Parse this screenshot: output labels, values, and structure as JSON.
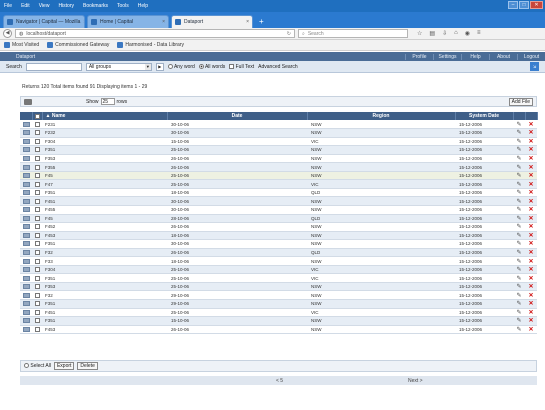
{
  "browser": {
    "menu": [
      "File",
      "Edit",
      "View",
      "History",
      "Bookmarks",
      "Tools",
      "Help"
    ],
    "tabs": [
      {
        "label": "Navigator | Capital — Mozilla",
        "active": false
      },
      {
        "label": "Home | Capital",
        "active": false
      },
      {
        "label": "Dataport",
        "active": true
      }
    ],
    "url": "localhost/dataport",
    "search_placeholder": "Search",
    "bookmarks": [
      "Most Visited",
      "Commissioned Gateway",
      "Harmonised - Data Library"
    ]
  },
  "app": {
    "title": "Dataport",
    "nav": [
      "Profile",
      "Settings",
      "Help",
      "About",
      "Logout"
    ],
    "search": {
      "label": "Search",
      "field_select": "All groups",
      "go_label": "Go",
      "radio_any": "Any word",
      "radio_all": "All words",
      "fulltext": "Full Text",
      "advanced": "Advanced Search"
    },
    "results_text": "Returns 120 Total items found 91 Displaying items 1 - 29",
    "toolbar": {
      "show_label": "Show",
      "page_size": "25",
      "show_suffix": "rows",
      "add_label": "Add File"
    },
    "columns": {
      "name": "Name",
      "date": "Date",
      "region": "Region",
      "system_date": "System Date"
    },
    "rows": [
      {
        "name": "F231",
        "date": "30-10-06",
        "region": "NSW",
        "sys": "15-12-2006"
      },
      {
        "name": "F232",
        "date": "30-10-06",
        "region": "NSW",
        "sys": "15-12-2006"
      },
      {
        "name": "F304",
        "date": "15-10-06",
        "region": "VIC",
        "sys": "15-12-2006"
      },
      {
        "name": "F351",
        "date": "25-10-06",
        "region": "NSW",
        "sys": "15-12-2006"
      },
      {
        "name": "F353",
        "date": "26-10-06",
        "region": "NSW",
        "sys": "15-12-2006"
      },
      {
        "name": "F355",
        "date": "26-10-06",
        "region": "NSW",
        "sys": "15-12-2006"
      },
      {
        "name": "F45",
        "date": "25-10-06",
        "region": "NSW",
        "sys": "15-12-2006"
      },
      {
        "name": "F47",
        "date": "25-10-06",
        "region": "VIC",
        "sys": "15-12-2006"
      },
      {
        "name": "F351",
        "date": "18-10-06",
        "region": "QLD",
        "sys": "15-12-2006"
      },
      {
        "name": "F451",
        "date": "30-10-06",
        "region": "NSW",
        "sys": "15-12-2006"
      },
      {
        "name": "F455",
        "date": "30-10-06",
        "region": "NSW",
        "sys": "15-12-2006"
      },
      {
        "name": "F45",
        "date": "28-10-06",
        "region": "QLD",
        "sys": "15-12-2006"
      },
      {
        "name": "F452",
        "date": "26-10-06",
        "region": "NSW",
        "sys": "15-12-2006"
      },
      {
        "name": "F453",
        "date": "18-10-06",
        "region": "NSW",
        "sys": "15-12-2006"
      },
      {
        "name": "F351",
        "date": "30-10-06",
        "region": "NSW",
        "sys": "15-12-2006"
      },
      {
        "name": "F32",
        "date": "26-10-06",
        "region": "QLD",
        "sys": "15-12-2006"
      },
      {
        "name": "F33",
        "date": "18-10-06",
        "region": "NSW",
        "sys": "15-12-2006"
      },
      {
        "name": "F304",
        "date": "25-10-06",
        "region": "VIC",
        "sys": "15-12-2006"
      },
      {
        "name": "F351",
        "date": "25-10-06",
        "region": "VIC",
        "sys": "15-12-2006"
      },
      {
        "name": "F353",
        "date": "25-10-06",
        "region": "NSW",
        "sys": "15-12-2006"
      },
      {
        "name": "F32",
        "date": "29-10-06",
        "region": "NSW",
        "sys": "15-12-2006"
      },
      {
        "name": "F351",
        "date": "29-10-06",
        "region": "NSW",
        "sys": "15-12-2006"
      },
      {
        "name": "F451",
        "date": "25-10-06",
        "region": "VIC",
        "sys": "15-12-2006"
      },
      {
        "name": "F351",
        "date": "15-10-06",
        "region": "NSW",
        "sys": "15-12-2006"
      },
      {
        "name": "F453",
        "date": "26-10-06",
        "region": "NSW",
        "sys": "15-12-2006"
      }
    ],
    "bottom": {
      "select_all": "Select All",
      "export": "Export",
      "delete": "Delete"
    },
    "pager": {
      "prev": "< 5",
      "next": "Next >"
    }
  }
}
